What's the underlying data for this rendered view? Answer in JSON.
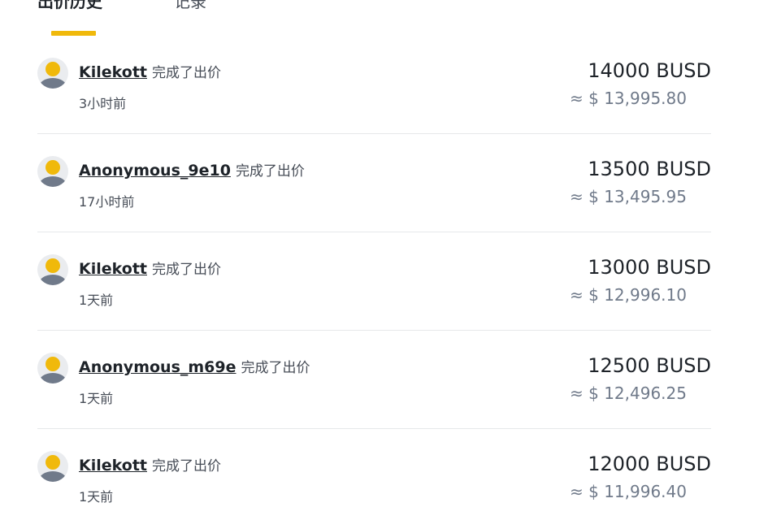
{
  "tabs": [
    {
      "label": "出价历史"
    },
    {
      "label": "记录"
    }
  ],
  "colors": {
    "accent": "#f0b90b",
    "divider": "#e6e8ea",
    "muted": "#707a8a"
  },
  "bids": [
    {
      "user": "Kilekott",
      "action": "完成了出价",
      "time": "3小时前",
      "amount": "14000 BUSD",
      "usd": "≈ $ 13,995.80"
    },
    {
      "user": "Anonymous_9e10",
      "action": "完成了出价",
      "time": "17小时前",
      "amount": "13500 BUSD",
      "usd": "≈ $ 13,495.95"
    },
    {
      "user": "Kilekott",
      "action": "完成了出价",
      "time": "1天前",
      "amount": "13000 BUSD",
      "usd": "≈ $ 12,996.10"
    },
    {
      "user": "Anonymous_m69e",
      "action": "完成了出价",
      "time": "1天前",
      "amount": "12500 BUSD",
      "usd": "≈ $ 12,496.25"
    },
    {
      "user": "Kilekott",
      "action": "完成了出价",
      "time": "1天前",
      "amount": "12000 BUSD",
      "usd": "≈ $ 11,996.40"
    }
  ]
}
